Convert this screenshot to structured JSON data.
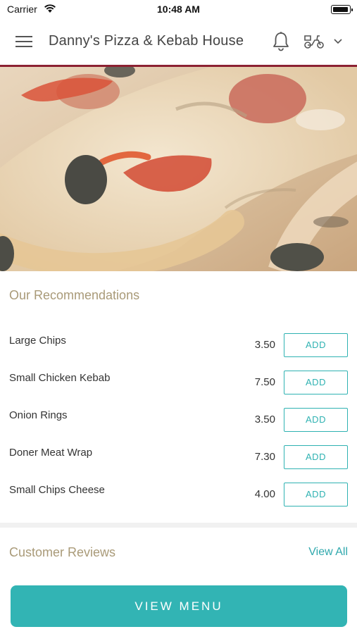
{
  "status_bar": {
    "carrier": "Carrier",
    "time": "10:48 AM"
  },
  "header": {
    "title": "Danny's Pizza & Kebab House",
    "menu_icon": "hamburger-menu-icon",
    "notification_icon": "bell-icon",
    "delivery_icon": "scooter-icon",
    "dropdown_icon": "chevron-down-icon"
  },
  "recommendations": {
    "title": "Our Recommendations",
    "items": [
      {
        "name": "Large Chips",
        "price": "3.50",
        "button": "ADD"
      },
      {
        "name": "Small Chicken Kebab",
        "price": "7.50",
        "button": "ADD"
      },
      {
        "name": "Onion Rings",
        "price": "3.50",
        "button": "ADD"
      },
      {
        "name": "Doner Meat Wrap",
        "price": "7.30",
        "button": "ADD"
      },
      {
        "name": "Small Chips Cheese",
        "price": "4.00",
        "button": "ADD"
      }
    ]
  },
  "reviews": {
    "title": "Customer Reviews",
    "view_all": "View All"
  },
  "footer": {
    "view_menu": "VIEW MENU"
  },
  "colors": {
    "accent": "#32b4b4",
    "header_rule": "#8c2132",
    "section_title": "#a99a78"
  }
}
